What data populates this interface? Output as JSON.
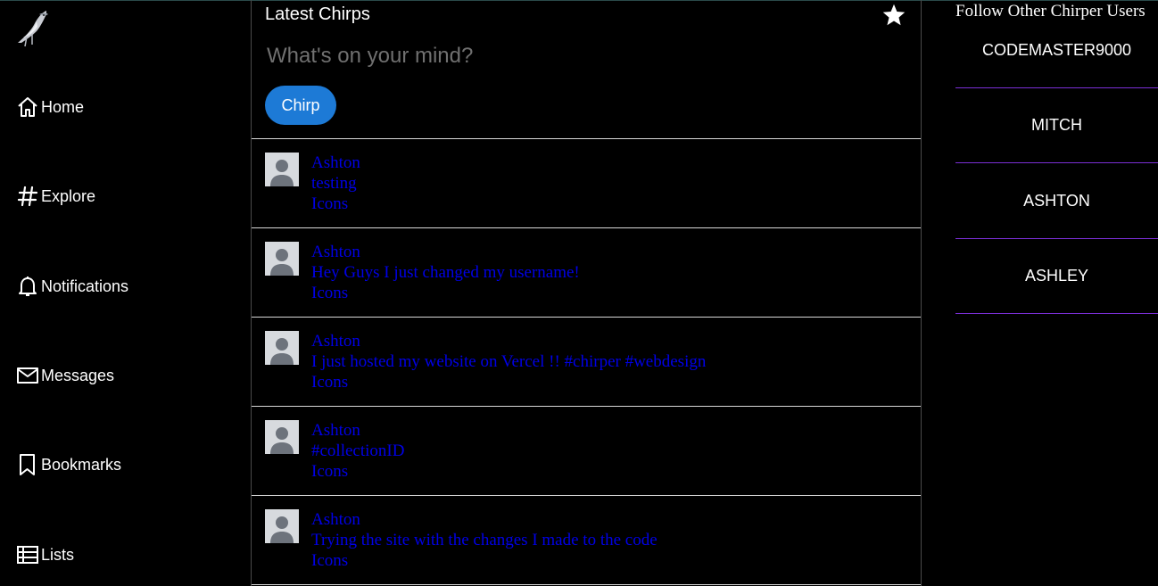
{
  "sidebar": {
    "logo_icon": "bird-logo-icon",
    "items": [
      {
        "label": "Home",
        "icon": "home-icon"
      },
      {
        "label": "Explore",
        "icon": "hashtag-icon"
      },
      {
        "label": "Notifications",
        "icon": "bell-icon"
      },
      {
        "label": "Messages",
        "icon": "envelope-icon"
      },
      {
        "label": "Bookmarks",
        "icon": "bookmark-icon"
      },
      {
        "label": "Lists",
        "icon": "list-icon"
      }
    ]
  },
  "feed": {
    "title": "Latest Chirps",
    "star_icon": "star-icon",
    "compose_placeholder": "What's on your mind?",
    "chirp_button": "Chirp",
    "posts": [
      {
        "author": "Ashton",
        "text": "testing",
        "icons_label": "Icons"
      },
      {
        "author": "Ashton",
        "text": "Hey Guys I just changed my username!",
        "icons_label": "Icons"
      },
      {
        "author": "Ashton",
        "text": "I just hosted my website on Vercel !! #chirper #webdesign",
        "icons_label": "Icons"
      },
      {
        "author": "Ashton",
        "text": "#collectionID",
        "icons_label": "Icons"
      },
      {
        "author": "Ashton",
        "text": "Trying the site with the changes I made to the code",
        "icons_label": "Icons"
      }
    ]
  },
  "follow": {
    "title": "Follow Other Chirper Users",
    "users": [
      "CODEMASTER9000",
      "MITCH",
      "ASHTON",
      "ASHLEY"
    ]
  },
  "colors": {
    "background": "#000000",
    "accent_button": "#1d7ad6",
    "link_text": "#0000e6",
    "user_divider": "#7b2fd6"
  }
}
